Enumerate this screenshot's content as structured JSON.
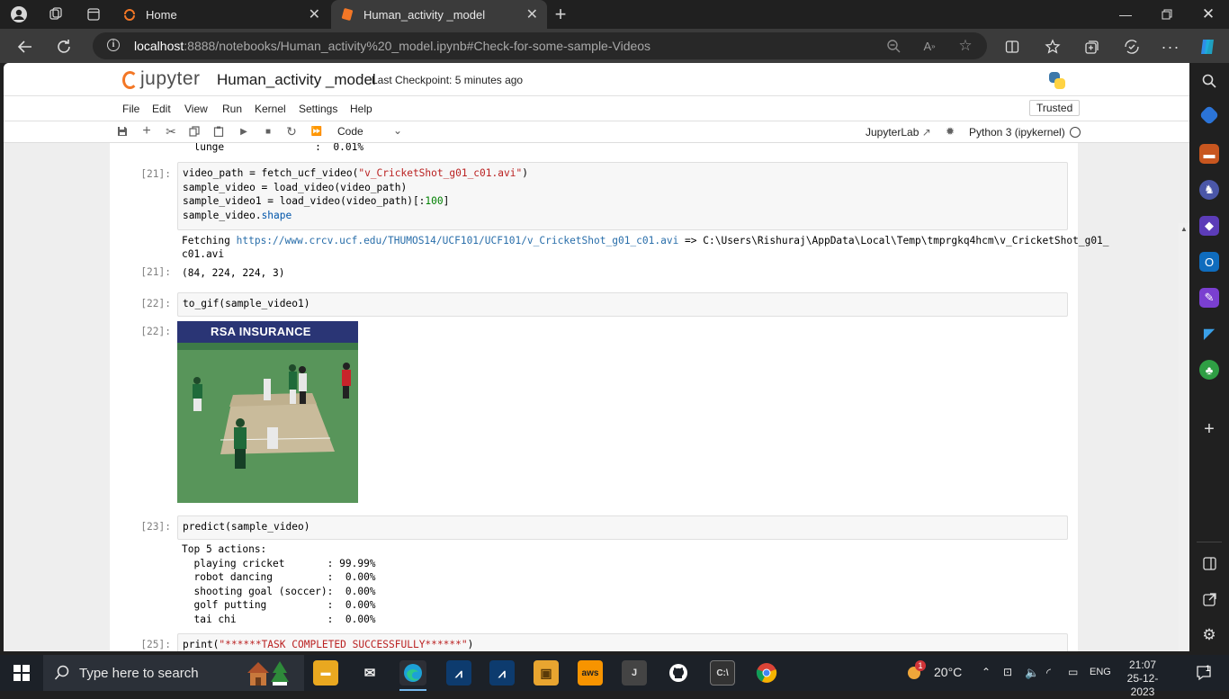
{
  "browser": {
    "tabs": [
      {
        "label": "Home"
      },
      {
        "label": "Human_activity _model"
      }
    ],
    "url_host": "localhost",
    "url_path": ":8888/notebooks/Human_activity%20_model.ipynb#Check-for-some-sample-Videos"
  },
  "jupyter": {
    "logo_text": "jupyter",
    "notebook_name": "Human_activity _model",
    "checkpoint": "Last Checkpoint: 5 minutes ago",
    "menus": [
      "File",
      "Edit",
      "View",
      "Run",
      "Kernel",
      "Settings",
      "Help"
    ],
    "trusted": "Trusted",
    "cell_type": "Code",
    "jupyterlab": "JupyterLab",
    "kernel": "Python 3 (ipykernel)"
  },
  "cells": {
    "prev_output": "  lunge               :  0.01%",
    "c21": {
      "prompt": "[21]:",
      "out_prompt": "[21]:",
      "fetch_prefix": "Fetching ",
      "fetch_url": "https://www.crcv.ucf.edu/THUMOS14/UCF101/UCF101/v_CricketShot_g01_c01.avi",
      "fetch_suffix": " => C:\\Users\\Rishuraj\\AppData\\Local\\Temp\\tmprgkq4hcm\\v_CricketShot_g01_",
      "fetch_line2": "c01.avi",
      "result": "(84, 224, 224, 3)"
    },
    "c22": {
      "prompt": "[22]:",
      "code": "to_gif(sample_video1)",
      "out_prompt": "[22]:",
      "banner": "RSA INSURANCE"
    },
    "c23": {
      "prompt": "[23]:",
      "code": "predict(sample_video)",
      "output": "Top 5 actions:\n  playing cricket       : 99.99%\n  robot dancing         :  0.00%\n  shooting goal (soccer):  0.00%\n  golf putting          :  0.00%\n  tai chi               :  0.00%"
    },
    "c25": {
      "prompt": "[25]:"
    }
  },
  "taskbar": {
    "search_placeholder": "Type here to search",
    "weather": "20°C",
    "lang": "ENG",
    "time": "21:07",
    "date": "25-12-2023",
    "badge": "1"
  }
}
